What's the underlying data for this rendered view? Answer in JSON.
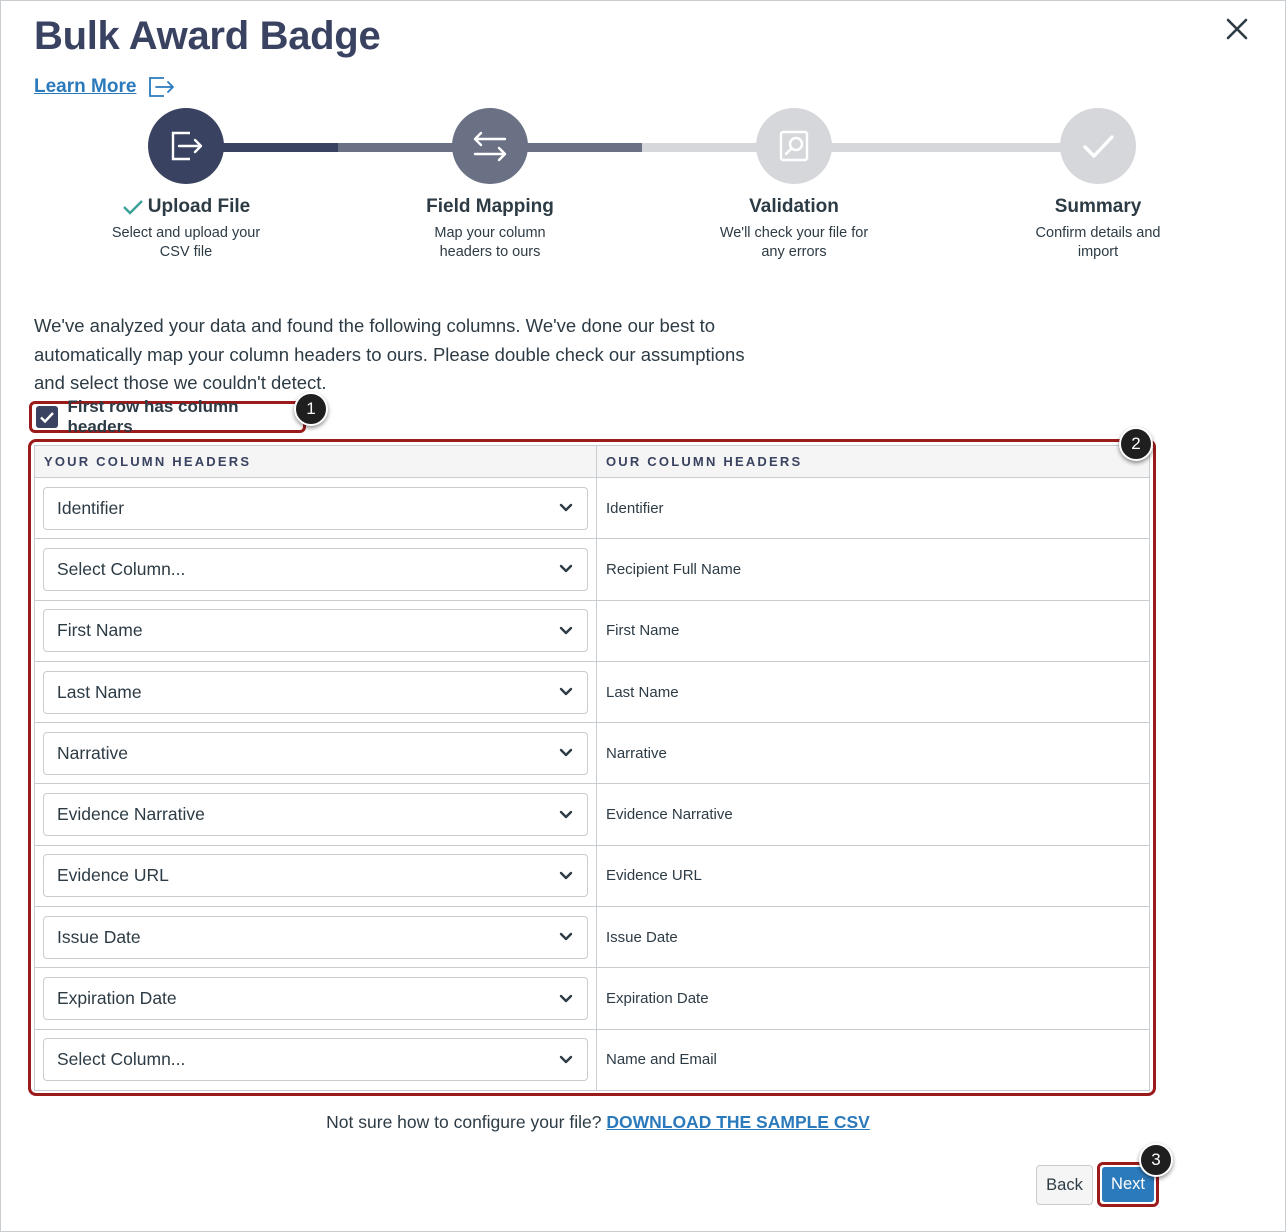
{
  "header": {
    "title": "Bulk Award Badge",
    "learn_more": "Learn More"
  },
  "steps": [
    {
      "label": "Upload File",
      "desc": "Select and upload your CSV file",
      "state": "complete",
      "icon": "upload-file-icon"
    },
    {
      "label": "Field Mapping",
      "desc": "Map your column headers to ours",
      "state": "current",
      "icon": "swap-arrows-icon"
    },
    {
      "label": "Validation",
      "desc": "We'll check your file for any errors",
      "state": "upcoming",
      "icon": "search-document-icon"
    },
    {
      "label": "Summary",
      "desc": "Confirm details and import",
      "state": "upcoming",
      "icon": "checkmark-icon"
    }
  ],
  "colors": {
    "complete": "#394260",
    "current": "#6b7185",
    "upcoming": "#d5d7db",
    "accent": "#2b7abc",
    "callout": "#9b1b1b"
  },
  "intro": "We've analyzed your data and found the following columns. We've done our best to automatically map your column headers to ours. Please double check our assumptions and select those we couldn't detect.",
  "first_row_checkbox": {
    "label": "First row has column headers",
    "checked": true
  },
  "table": {
    "headers": [
      "YOUR COLUMN HEADERS",
      "OUR COLUMN HEADERS"
    ],
    "rows": [
      {
        "select": "Identifier",
        "ours": "Identifier"
      },
      {
        "select": "Select Column...",
        "ours": "Recipient Full Name"
      },
      {
        "select": "First Name",
        "ours": "First Name"
      },
      {
        "select": "Last Name",
        "ours": "Last Name"
      },
      {
        "select": "Narrative",
        "ours": "Narrative"
      },
      {
        "select": "Evidence Narrative",
        "ours": "Evidence Narrative"
      },
      {
        "select": "Evidence URL",
        "ours": "Evidence URL"
      },
      {
        "select": "Issue Date",
        "ours": "Issue Date"
      },
      {
        "select": "Expiration Date",
        "ours": "Expiration Date"
      },
      {
        "select": "Select Column...",
        "ours": "Name and Email"
      }
    ]
  },
  "footer": {
    "note": "Not sure how to configure your file?",
    "download_link": "DOWNLOAD THE SAMPLE CSV"
  },
  "buttons": {
    "back": "Back",
    "next": "Next"
  },
  "callouts": [
    "1",
    "2",
    "3"
  ]
}
